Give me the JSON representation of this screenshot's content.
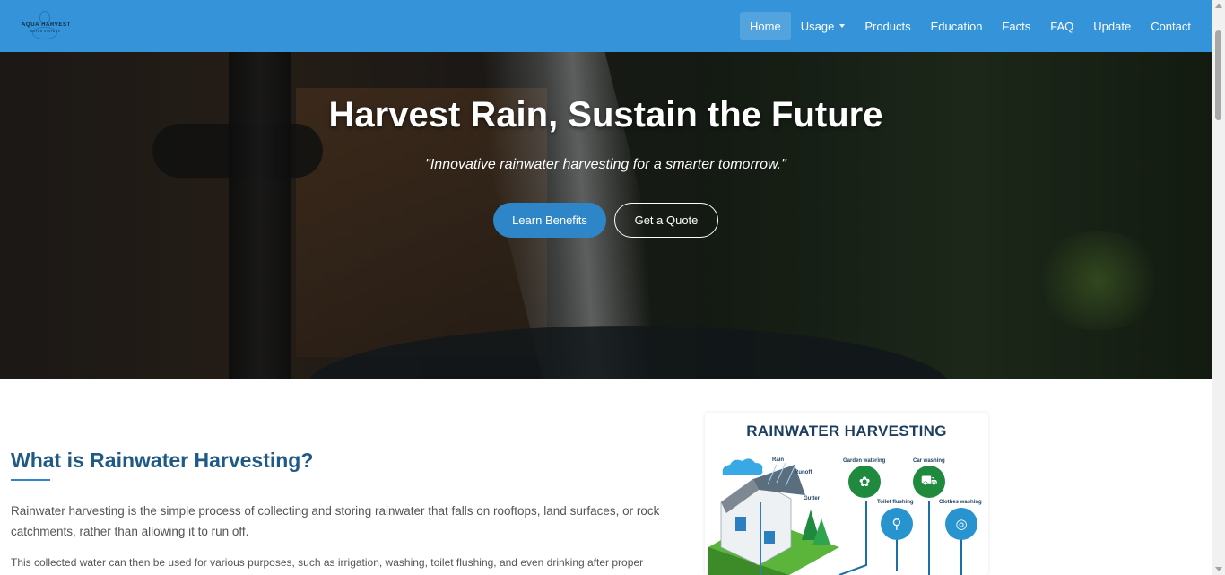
{
  "brand": {
    "logo_text": "AQUA HARVEST",
    "logo_tagline": "WATER SYSTEMS"
  },
  "nav": {
    "items": [
      {
        "label": "Home",
        "active": true
      },
      {
        "label": "Usage",
        "dropdown": true
      },
      {
        "label": "Products"
      },
      {
        "label": "Education"
      },
      {
        "label": "Facts"
      },
      {
        "label": "FAQ"
      },
      {
        "label": "Update"
      },
      {
        "label": "Contact"
      }
    ]
  },
  "hero": {
    "title": "Harvest Rain, Sustain the Future",
    "subtitle": "\"Innovative rainwater harvesting for a smarter tomorrow.\"",
    "primary_button": "Learn Benefits",
    "secondary_button": "Get a Quote"
  },
  "about": {
    "title": "What is Rainwater Harvesting?",
    "paragraph1": "Rainwater harvesting is the simple process of collecting and storing rainwater that falls on rooftops, land surfaces, or rock catchments, rather than allowing it to run off.",
    "paragraph2": "This collected water can then be used for various purposes, such as irrigation, washing, toilet flushing, and even drinking after proper"
  },
  "infographic": {
    "title": "RAINWATER HARVESTING",
    "labels": {
      "rain": "Rain",
      "runoff": "Runoff",
      "gutter": "Gutter",
      "garden": "Garden watering",
      "car": "Car washing",
      "toilet": "Toilet flushing",
      "clothes": "Clothes washing"
    }
  },
  "colors": {
    "navbar": "#3593d9",
    "primary_button": "#2e86c8",
    "heading": "#1e5a86"
  }
}
